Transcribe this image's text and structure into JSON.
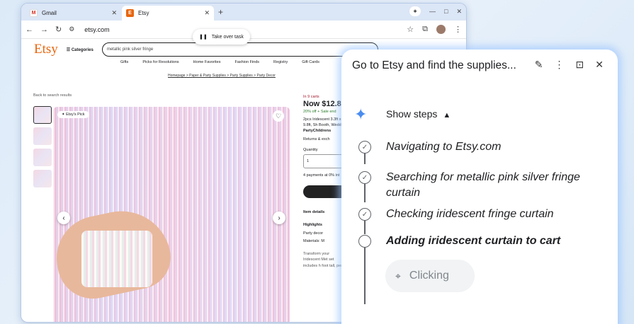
{
  "browser": {
    "tabs": [
      {
        "label": "Gmail"
      },
      {
        "label": "Etsy"
      }
    ],
    "new_tab_icon": "+",
    "url": "etsy.com",
    "take_over": "Take over task"
  },
  "etsy": {
    "logo": "Etsy",
    "categories": "Categories",
    "search_value": "metallic pink silver fringe",
    "nav": [
      "Gifts",
      "Picks for Resolutions",
      "Home Favorites",
      "Fashion Finds",
      "Registry",
      "Gift Cards"
    ],
    "breadcrumb": "Homepage > Paper & Party Supplies > Party Supplies > Party Decor",
    "back": "Back to search results",
    "badge": "Etsy's Pick",
    "in_carts": "In 9 carts",
    "price": "Now $12.8",
    "discount": "20% off + Sale end",
    "desc": "2pcs Iridescent 3.3ft x 9.8ft, Sh Booth, Weddin",
    "shop": "PartyChildrens",
    "returns": "Returns & exch",
    "quantity_label": "Quantity",
    "quantity_value": "1",
    "payments": "4 payments at 0% int",
    "item_details": "Item details",
    "highlights": "Highlights",
    "hl1": "Party decor",
    "hl2": "Materials: M",
    "transform": "Transform your Iridescent Met set includes h foot tall, perfe"
  },
  "panel": {
    "title": "Go to Etsy and find the supplies...",
    "show_steps": "Show steps",
    "steps": [
      {
        "label": "Navigating to Etsy.com",
        "status": "done"
      },
      {
        "label": "Searching for metallic pink silver fringe curtain",
        "status": "done"
      },
      {
        "label": "Checking iridescent fringe curtain",
        "status": "done"
      },
      {
        "label": "Adding iridescent curtain to cart",
        "status": "active"
      }
    ],
    "status": "Clicking"
  }
}
